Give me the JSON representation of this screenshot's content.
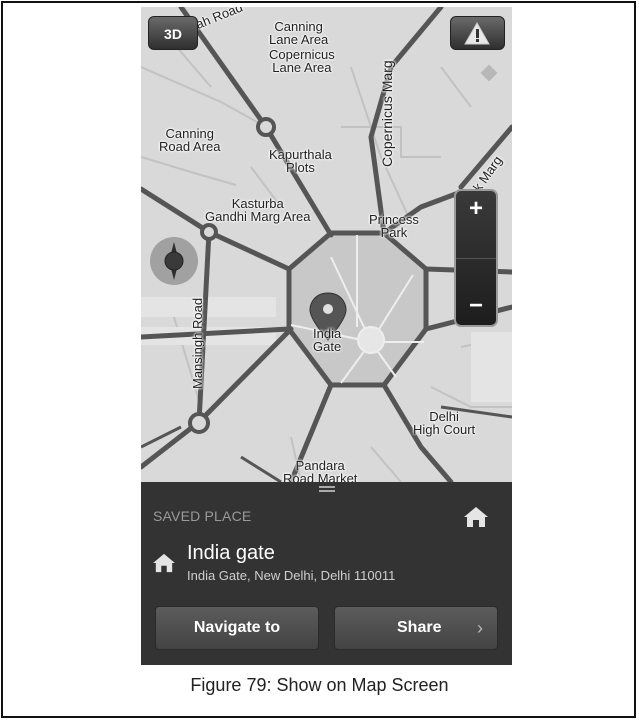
{
  "map": {
    "labels": {
      "firoz_shah_road": "Firoz Shah Road",
      "canning_lane_area": "Canning\nLane Area",
      "copernicus_lane_area": "Copernicus\nLane Area",
      "copernicus_marg": "Copernicus Marg",
      "canning_road_area": "Canning\nRoad Area",
      "kapurthala_plots": "Kapurthala\nPlots",
      "kasturba_gandhi_marg_area": "Kasturba\nGandhi Marg Area",
      "tilak_marg": "Tilak Marg",
      "princess_park": "Princess\nPark",
      "mansingh_road": "Mansingh Road",
      "india_gate": "India\nGate",
      "delhi_high_court": "Delhi\nHigh Court",
      "pandara_road_market": "Pandara\nRoad Market"
    },
    "btn_3d": "3D",
    "zoom_in": "+",
    "zoom_out": "−",
    "icons": {
      "warning": "warning-icon",
      "compass": "compass-icon",
      "pin": "location-pin-icon"
    }
  },
  "panel": {
    "section_label": "SAVED PLACE",
    "place_name": "India gate",
    "place_address": "India Gate, New Delhi, Delhi 110011",
    "navigate_label": "Navigate to",
    "share_label": "Share",
    "share_chevron": "›",
    "icons": {
      "header_home": "home-icon",
      "place_home": "home-icon",
      "drag_handle": "drag-handle-icon"
    }
  },
  "caption": "Figure 79: Show on Map Screen",
  "colors": {
    "map_bg": "#d9d9d9",
    "road": "#555555",
    "panel_bg": "#333333"
  }
}
